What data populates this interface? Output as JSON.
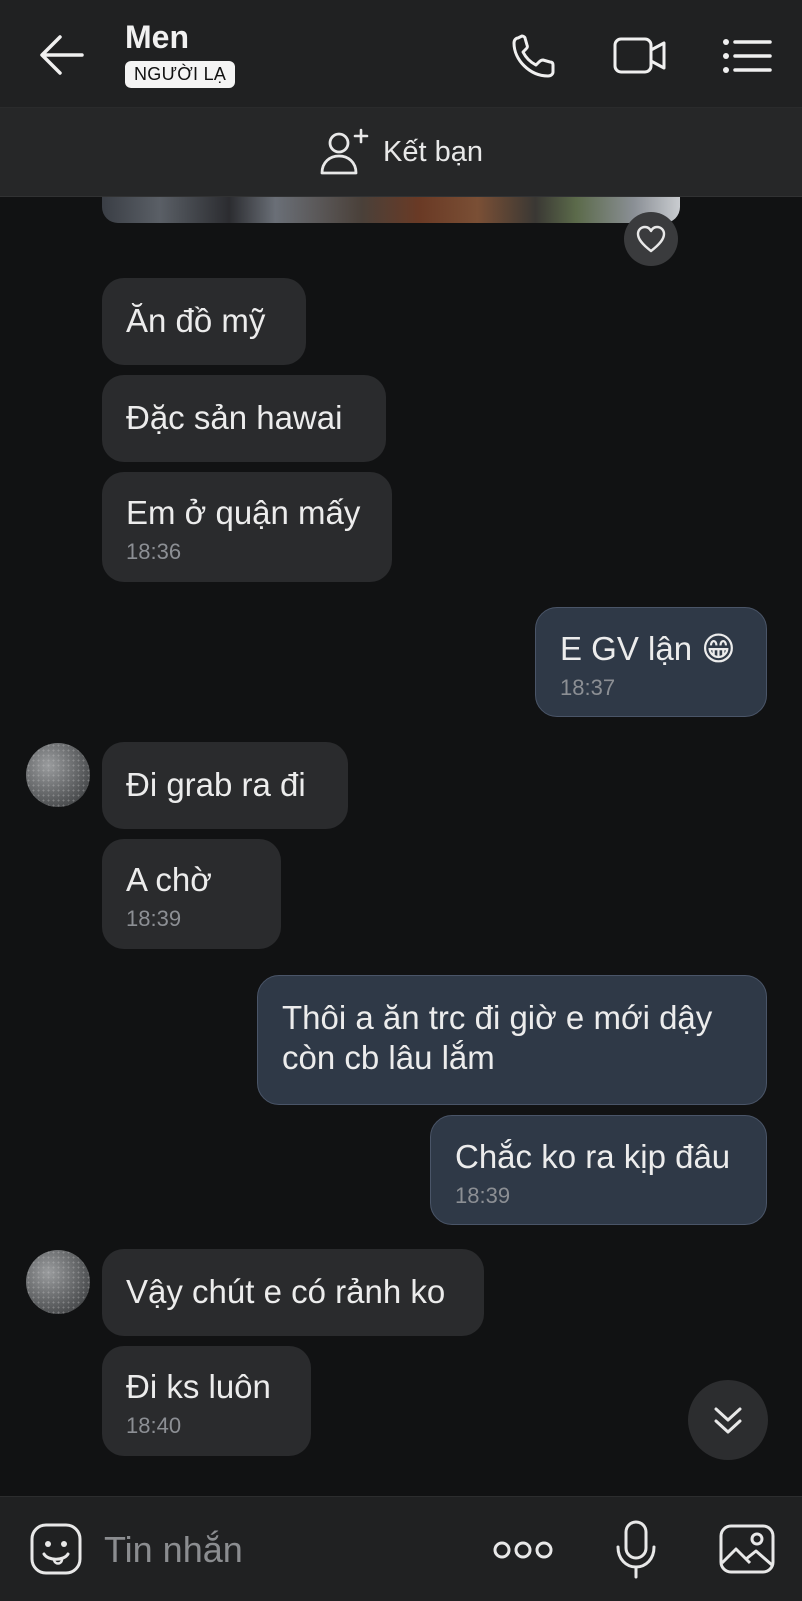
{
  "header": {
    "contact_name": "Men",
    "badge": "NGƯỜI LẠ",
    "icons": [
      "back-arrow-icon",
      "phone-icon",
      "video-camera-icon",
      "list-menu-icon"
    ]
  },
  "friend_bar": {
    "label": "Kết bạn",
    "icon": "add-person-icon"
  },
  "messages": [
    {
      "side": "in",
      "text": "Ăn đồ mỹ",
      "time": ""
    },
    {
      "side": "in",
      "text": "Đặc sản hawai",
      "time": ""
    },
    {
      "side": "in",
      "text": "Em ở quận mấy",
      "time": "18:36"
    },
    {
      "side": "out",
      "text": "E GV lận 😁",
      "time": "18:37"
    },
    {
      "side": "in",
      "text": "Đi grab ra đi",
      "time": ""
    },
    {
      "side": "in",
      "text": "A chờ",
      "time": "18:39"
    },
    {
      "side": "out",
      "text": "Thôi a ăn trc đi giờ e mới dậy còn cb lâu lắm",
      "time": ""
    },
    {
      "side": "out",
      "text": "Chắc ko ra kịp đâu",
      "time": "18:39"
    },
    {
      "side": "in",
      "text": "Vậy chút e có rảnh ko",
      "time": ""
    },
    {
      "side": "in",
      "text": "Đi ks luôn",
      "time": "18:40"
    }
  ],
  "composer": {
    "placeholder": "Tin nhắn",
    "icons": [
      "sticker-icon",
      "more-options-icon",
      "microphone-icon",
      "gallery-icon"
    ]
  },
  "colors": {
    "background": "#111213",
    "incoming_bubble": "#2a2b2d",
    "outgoing_bubble": "#2f3947",
    "timestamp": "#8c8f94"
  }
}
